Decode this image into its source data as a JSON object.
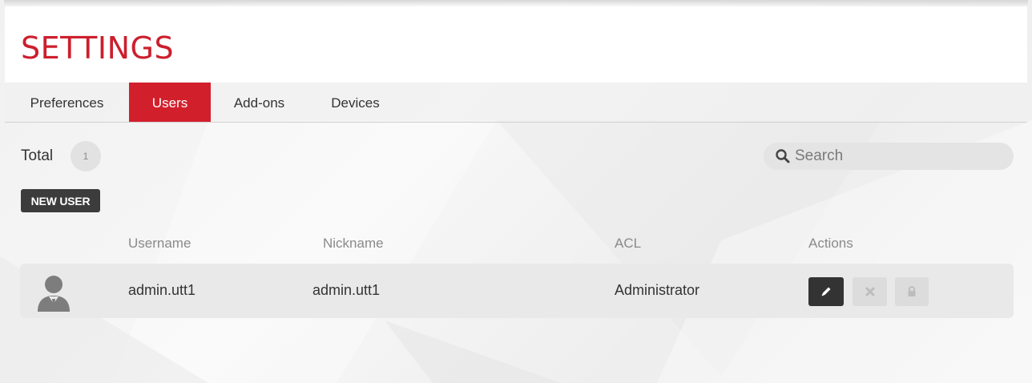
{
  "page": {
    "title": "SETTINGS"
  },
  "tabs": [
    {
      "label": "Preferences",
      "active": false
    },
    {
      "label": "Users",
      "active": true
    },
    {
      "label": "Add-ons",
      "active": false
    },
    {
      "label": "Devices",
      "active": false
    }
  ],
  "summary": {
    "total_label": "Total",
    "total_count": "1"
  },
  "search": {
    "placeholder": "Search",
    "value": ""
  },
  "toolbar": {
    "new_user_label": "NEW USER"
  },
  "table": {
    "columns": [
      "Username",
      "Nickname",
      "ACL",
      "Actions"
    ],
    "rows": [
      {
        "username": "admin.utt1",
        "nickname": "admin.utt1",
        "acl": "Administrator"
      }
    ],
    "actions": [
      "pencil-icon",
      "close-icon",
      "lock-icon"
    ]
  },
  "colors": {
    "accent": "#d21f2c",
    "title": "#cc1f2d",
    "dark_button": "#333333"
  }
}
